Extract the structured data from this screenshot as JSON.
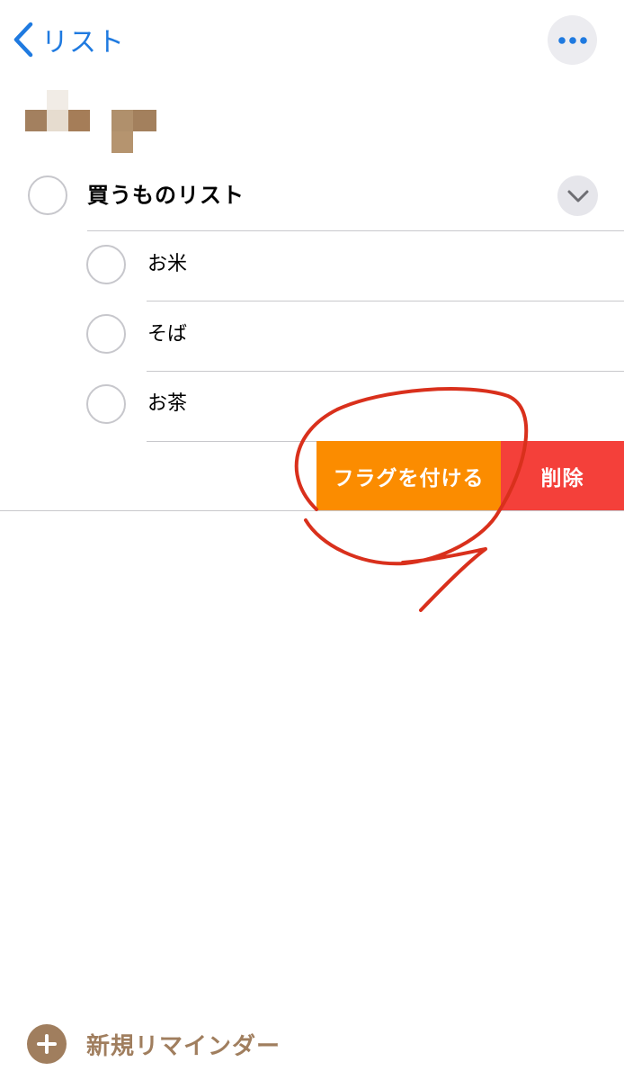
{
  "nav": {
    "back_label": "リスト",
    "accent_color": "#1f7ae0"
  },
  "list_title_icon": "pixelated-mosaic-title",
  "reminder": {
    "title": "買うものリスト",
    "subtasks": [
      {
        "label": "お米"
      },
      {
        "label": "そば"
      },
      {
        "label": "お茶"
      }
    ]
  },
  "swipe_actions": {
    "flag_label": "フラグを付ける",
    "flag_color": "#fb8c00",
    "delete_label": "削除",
    "delete_color": "#f4403a"
  },
  "annotation_color": "#d9301c",
  "footer": {
    "new_reminder_label": "新規リマインダー",
    "color": "#a07e5e"
  }
}
